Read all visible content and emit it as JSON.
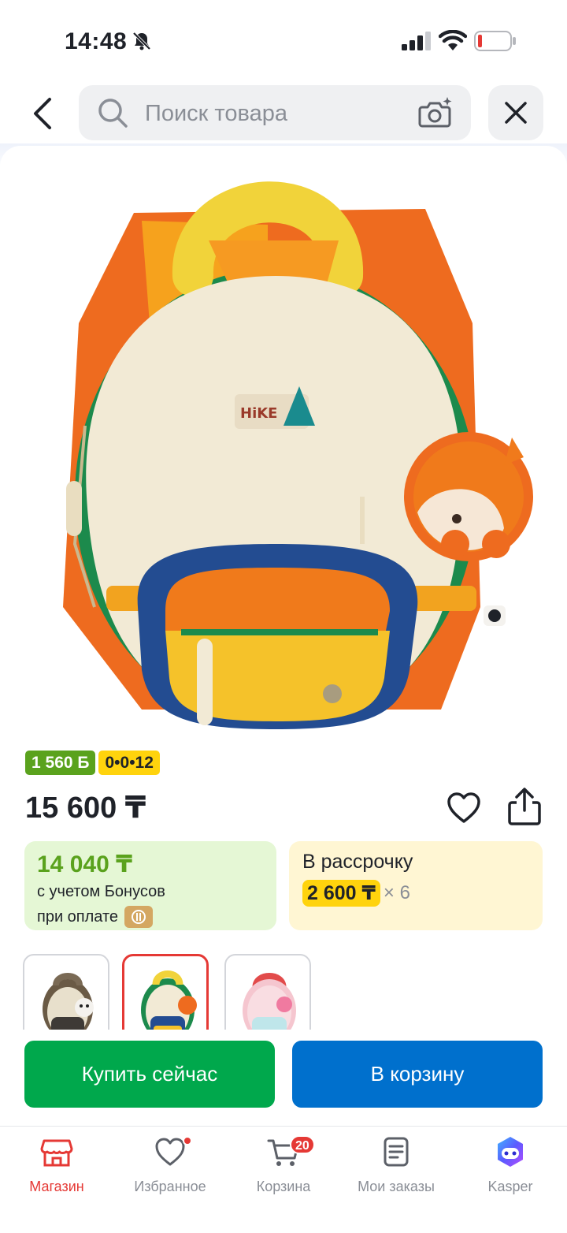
{
  "status_bar": {
    "time": "14:48"
  },
  "search": {
    "placeholder": "Поиск товара"
  },
  "product": {
    "badge_bonus": "1 560 Б",
    "badge_installment": "0•0•12",
    "price": "15 600 ₸"
  },
  "promo_bonus": {
    "amount": "14 040 ₸",
    "line1": "с учетом Бонусов",
    "line2": "при оплате"
  },
  "promo_installment": {
    "title": "В рассрочку",
    "amount": "2 600 ₸",
    "multiplier": "× 6"
  },
  "variants": [
    {
      "name": "beige-panda"
    },
    {
      "name": "cream-fox"
    },
    {
      "name": "pink-cat"
    }
  ],
  "actions": {
    "buy_now": "Купить сейчас",
    "add_to_cart": "В корзину"
  },
  "bottom_nav": {
    "shop": "Магазин",
    "favorites": "Избранное",
    "cart": "Корзина",
    "cart_count": "20",
    "orders": "Мои заказы",
    "assistant": "Kasper"
  },
  "colors": {
    "accent_red": "#e53935",
    "buy_green": "#00a84c",
    "cart_blue": "#0070cd",
    "bonus_green": "#5aa21d",
    "installment_yellow": "#ffd30d"
  }
}
